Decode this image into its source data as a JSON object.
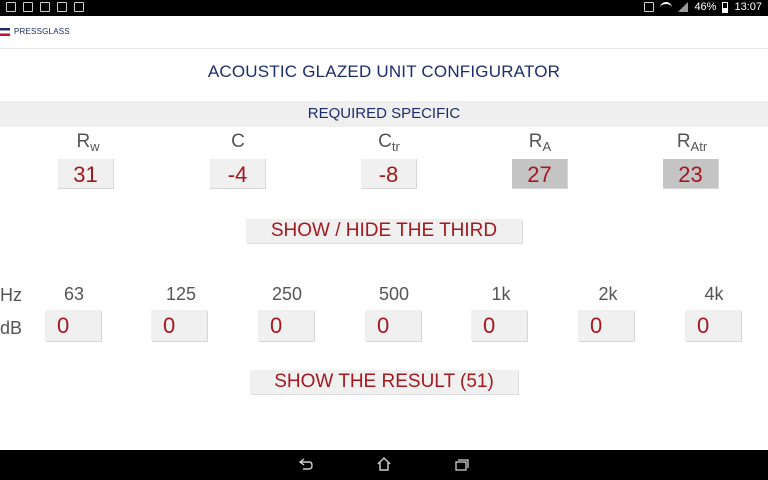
{
  "status": {
    "battery": "46%",
    "time": "13:07"
  },
  "app": {
    "brand": "PRESSGLASS"
  },
  "title": "ACOUSTIC GLAZED UNIT CONFIGURATOR",
  "section": "REQUIRED SPECIFIC",
  "params": [
    {
      "base": "R",
      "sub": "w",
      "value": "31"
    },
    {
      "base": "C",
      "sub": "",
      "value": "-4"
    },
    {
      "base": "C",
      "sub": "tr",
      "value": "-8"
    },
    {
      "base": "R",
      "sub": "A",
      "value": "27"
    },
    {
      "base": "R",
      "sub": "Atr",
      "value": "23"
    }
  ],
  "buttons": {
    "toggle": "SHOW / HIDE THE THIRD",
    "result": "SHOW THE RESULT (51)"
  },
  "freq": {
    "hz_label": "Hz",
    "db_label": "dB",
    "bands": [
      "63",
      "125",
      "250",
      "500",
      "1k",
      "2k",
      "4k"
    ],
    "values": [
      "0",
      "0",
      "0",
      "0",
      "0",
      "0",
      "0"
    ]
  }
}
